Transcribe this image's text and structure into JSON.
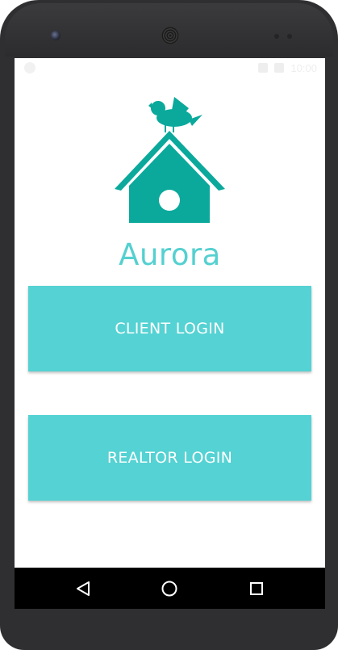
{
  "app": {
    "name": "Aurora"
  },
  "status_bar": {
    "time": "10:00"
  },
  "buttons": {
    "client_login": "CLIENT LOGIN",
    "realtor_login": "REALTOR LOGIN"
  },
  "colors": {
    "accent": "#55d2d3",
    "logo": "#0aa99c",
    "button_text": "#ffffff",
    "nav_bar": "#000000"
  },
  "icons": {
    "logo": "birdhouse-with-bird-icon",
    "nav_back": "back-triangle-icon",
    "nav_home": "home-circle-icon",
    "nav_recents": "recents-square-icon"
  }
}
